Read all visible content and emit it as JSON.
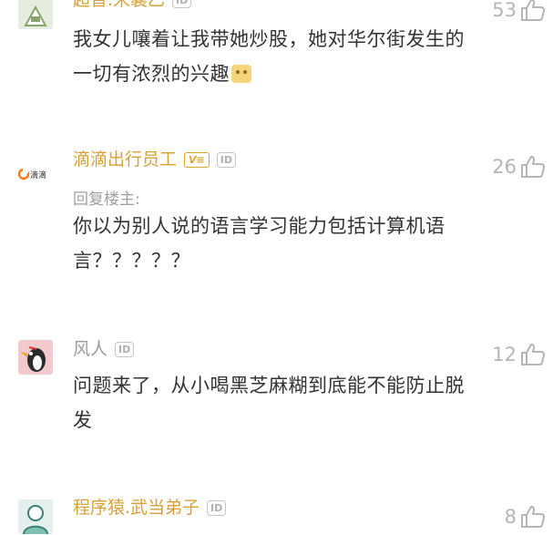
{
  "comments": [
    {
      "name": "超普.宋襄乙",
      "text": "我女儿嚷着让我带她炒股，她对华尔街发生的一切有浓烈的兴趣",
      "likes": "53"
    },
    {
      "name": "滴滴出行员工",
      "badge": "V≡",
      "avatar_label": "滴滴",
      "reply_label": "回复楼主:",
      "text": "你以为别人说的语言学习能力包括计算机语言？？？？？",
      "likes": "26"
    },
    {
      "name": "风人",
      "text": "问题来了，从小喝黑芝麻糊到底能不能防止脱发",
      "likes": "12"
    },
    {
      "name": "程序猿.武当弟子",
      "text": "",
      "likes": "8"
    }
  ],
  "id_badge": "ID",
  "colors": {
    "gold_name": "#d9a03a",
    "grey_name": "#9a9a9a",
    "like": "#b5b5b5",
    "text": "#333333"
  },
  "icons": [
    "thumbs-up-icon",
    "id-badge-icon",
    "verified-badge-icon"
  ]
}
